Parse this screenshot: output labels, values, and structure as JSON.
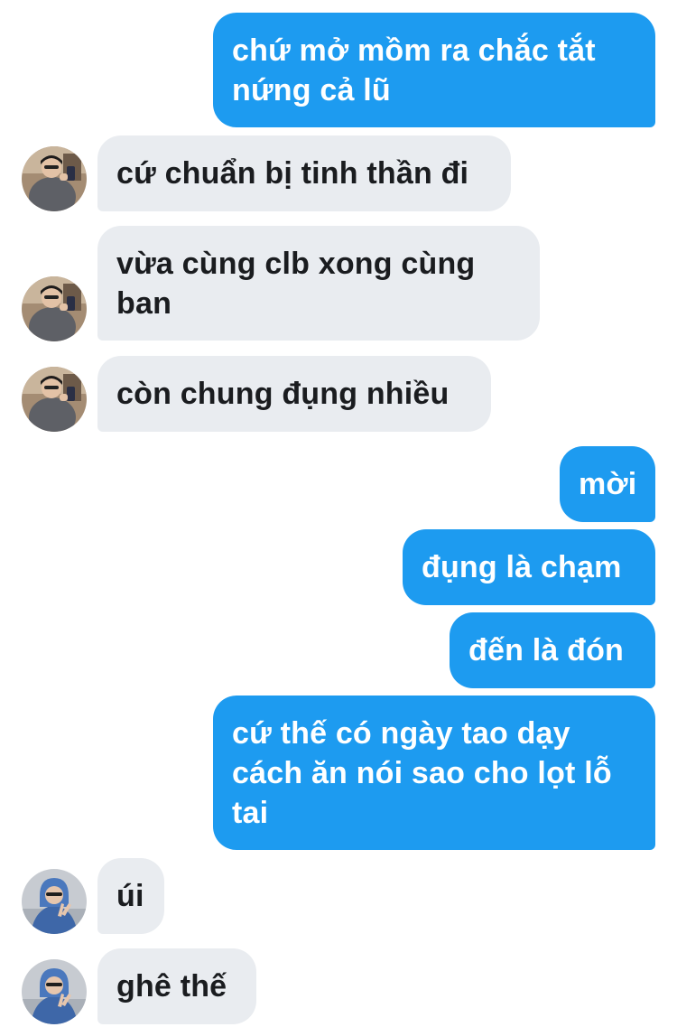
{
  "conversation": {
    "messages": [
      {
        "side": "out",
        "text": "chứ mở mồm ra chắc tắt\nnứng cả lũ"
      },
      {
        "side": "in",
        "avatar": "profile-photo-gray-jacket",
        "text": "cứ chuẩn bị tinh thần đi"
      },
      {
        "side": "in",
        "avatar": "profile-photo-gray-jacket",
        "text": "vừa cùng clb xong cùng\nban"
      },
      {
        "side": "in",
        "avatar": "profile-photo-gray-jacket",
        "text": "còn chung đụng nhiều"
      },
      {
        "side": "out",
        "text": "mời"
      },
      {
        "side": "out",
        "text": "đụng là chạm"
      },
      {
        "side": "out",
        "text": "đến là đón"
      },
      {
        "side": "out",
        "text": "cứ thế có ngày tao dạy\ncách ăn nói sao cho lọt lỗ\ntai"
      },
      {
        "side": "in",
        "avatar": "profile-photo-blue-hoodie",
        "text": "úi"
      },
      {
        "side": "in",
        "avatar": "profile-photo-blue-hoodie",
        "text": "ghê thế"
      }
    ]
  },
  "colors": {
    "outgoing_bubble": "#1d9bf0",
    "incoming_bubble": "#e9ecf0",
    "incoming_text": "#1a1c1f",
    "outgoing_text": "#ffffff"
  }
}
